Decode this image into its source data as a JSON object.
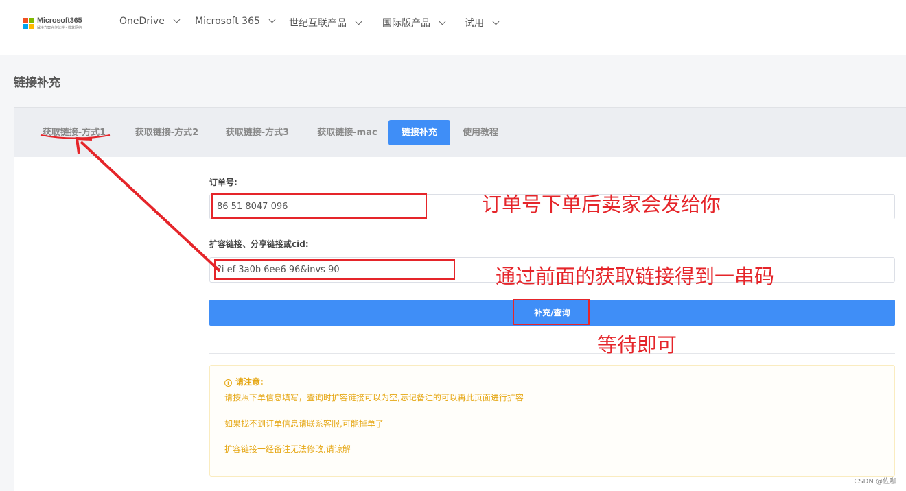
{
  "header": {
    "logo": {
      "name": "Microsoft365",
      "tagline": "解决方案合作伙伴 - 微软网络"
    },
    "nav": [
      {
        "label": "OneDrive"
      },
      {
        "label": "Microsoft 365"
      },
      {
        "label": "世纪互联产品"
      },
      {
        "label": "国际版产品"
      },
      {
        "label": "试用"
      }
    ]
  },
  "page": {
    "title": "链接补充"
  },
  "tabs": [
    {
      "label": "获取链接-方式1",
      "active": false
    },
    {
      "label": "获取链接-方式2",
      "active": false
    },
    {
      "label": "获取链接-方式3",
      "active": false
    },
    {
      "label": "获取链接-mac",
      "active": false
    },
    {
      "label": "链接补充",
      "active": true
    },
    {
      "label": "使用教程",
      "active": false
    }
  ],
  "form": {
    "order_label": "订单号:",
    "order_value": "  86   51  8047  096",
    "link_label": "扩容链接、分享链接或cid:",
    "link_value": "?i    ef   3a0b    6ee6    96&invs    90",
    "submit_label": "补充/查询"
  },
  "notice": {
    "icon": "info-circle-icon",
    "title": "请注意:",
    "lines": [
      "请按照下单信息填写，查询时扩容链接可以为空,忘记备注的可以再此页面进行扩容",
      "如果找不到订单信息请联系客服,可能掉单了",
      "扩容链接一经备注无法修改,请谅解"
    ]
  },
  "annotations": {
    "order_note": "订单号下单后卖家会发给你",
    "link_note": "通过前面的获取链接得到一串码",
    "submit_note": "等待即可"
  },
  "watermark": "CSDN @佐咖",
  "colors": {
    "primary": "#3f8ef7",
    "warning": "#e6a817",
    "annotation": "#e5252a"
  }
}
